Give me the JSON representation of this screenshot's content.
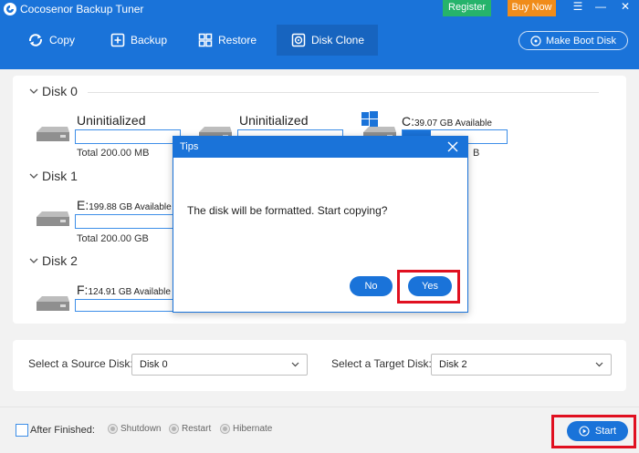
{
  "app": {
    "title": "Cocosenor Backup Tuner",
    "register_label": "Register",
    "buynow_label": "Buy Now"
  },
  "window_controls": {
    "menu": "☰",
    "minimize": "—",
    "close": "✕"
  },
  "toolbar": {
    "copy": "Copy",
    "backup": "Backup",
    "restore": "Restore",
    "disk_clone": "Disk Clone",
    "make_boot_disk": "Make Boot Disk",
    "active_tab": "Disk Clone"
  },
  "disks": [
    {
      "label": "Disk 0",
      "partitions": [
        {
          "name": "Uninitialized",
          "available": "",
          "fill": 0,
          "icon": "hdd-icon"
        },
        {
          "name": "Uninitialized",
          "available": "",
          "fill": 0,
          "icon": "hdd-icon"
        },
        {
          "name": "C:",
          "available": "39.07 GB Available",
          "fill": 0.27,
          "icon": "windows-hdd-icon"
        }
      ],
      "total": "Total 200.00 MB",
      "total_partial": "B"
    },
    {
      "label": "Disk 1",
      "partitions": [
        {
          "name": "E:",
          "available": "199.88 GB Available",
          "fill": 0,
          "icon": "hdd-icon"
        }
      ],
      "total": "Total 200.00 GB"
    },
    {
      "label": "Disk 2",
      "partitions": [
        {
          "name": "F:",
          "available": "124.91 GB Available",
          "fill": 0,
          "icon": "hdd-icon"
        }
      ]
    }
  ],
  "selectors": {
    "source_label": "Select a Source Disk:",
    "source_value": "Disk 0",
    "target_label": "Select a Target Disk:",
    "target_value": "Disk 2"
  },
  "bottom": {
    "after_finished": "After Finished:",
    "options": [
      "Shutdown",
      "Restart",
      "Hibernate"
    ],
    "start_label": "Start"
  },
  "dialog": {
    "title": "Tips",
    "message": "The disk will be formatted. Start copying?",
    "no_label": "No",
    "yes_label": "Yes"
  },
  "colors": {
    "brand_blue": "#1a73d9",
    "register_green": "#26b36b",
    "buynow_orange": "#f08c1a",
    "highlight_red": "#e01020"
  }
}
